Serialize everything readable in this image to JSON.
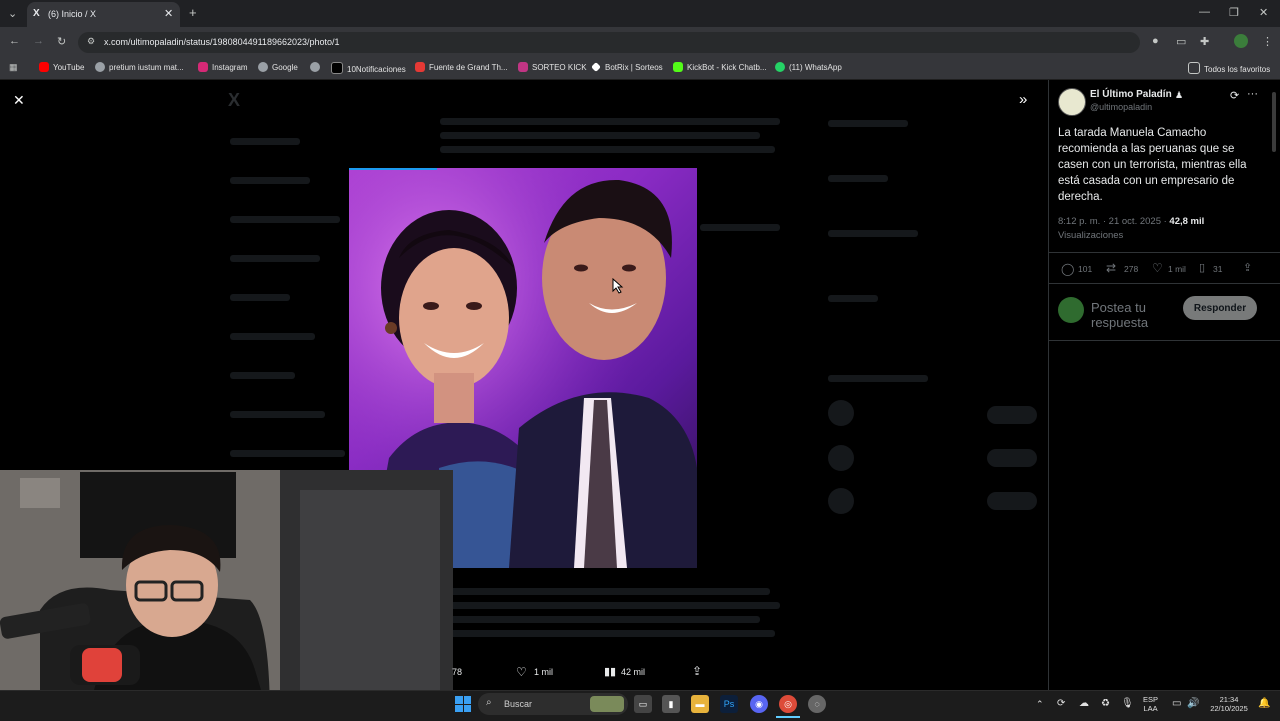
{
  "browser": {
    "tab_title": "(6) Inicio / X",
    "tab_favicon": "X",
    "url": "x.com/ultimopaladin/status/1980804491189662023/photo/1",
    "bookmarks": [
      {
        "label": "YouTube",
        "color": "#ff0000"
      },
      {
        "label": "pretium iustum mat...",
        "color": "#9aa0a6"
      },
      {
        "label": "Instagram",
        "color": "#d62976"
      },
      {
        "label": "Google",
        "color": "#9aa0a6"
      },
      {
        "label": "",
        "color": "#9aa0a6"
      },
      {
        "label": "10Notificaciones",
        "color": "#ffffff"
      },
      {
        "label": "Fuente de Grand Th...",
        "color": "#e53935"
      },
      {
        "label": "SORTEO KICK",
        "color": "#c13584"
      },
      {
        "label": "BotRix | Sorteos",
        "color": "#ffffff"
      },
      {
        "label": "KickBot - Kick Chatb...",
        "color": "#53fc18"
      },
      {
        "label": "(11) WhatsApp",
        "color": "#25d366"
      }
    ],
    "all_bookmarks": "Todos los favoritos"
  },
  "photo_actions": {
    "reposts": "78",
    "likes": "1 mil",
    "views": "42 mil"
  },
  "post": {
    "author": "El Último Paladín",
    "handle": "@ultimopaladin",
    "text": "La tarada Manuela Camacho recomienda a las peruanas que se casen con un terrorista, mientras ella está casada con un empresario de derecha.",
    "time": "8:12 p. m. · 21 oct. 2025 · ",
    "view_count": "42,8 mil",
    "views_label": "Visualizaciones",
    "replies": "101",
    "reposts": "278",
    "likes": "1 mil",
    "bookmarks": "31",
    "reply_placeholder": "Postea tu respuesta",
    "reply_button": "Responder"
  },
  "taskbar": {
    "search_placeholder": "Buscar",
    "lang_top": "ESP",
    "lang_bottom": "LAA",
    "time": "21:34",
    "date": "22/10/2025"
  },
  "colors": {
    "accent": "#1d9bf0",
    "panel_border": "#2f3336"
  }
}
